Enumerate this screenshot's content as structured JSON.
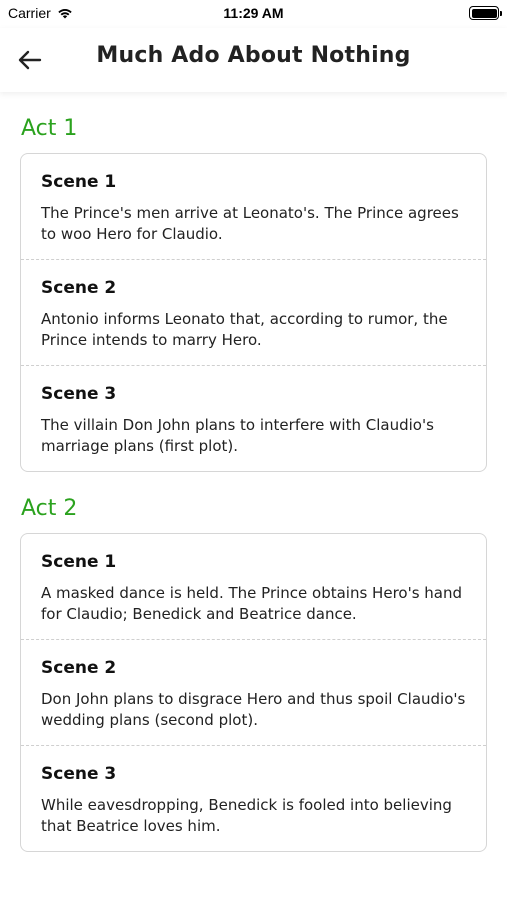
{
  "status_bar": {
    "carrier": "Carrier",
    "time": "11:29 AM"
  },
  "header": {
    "title": "Much Ado About Nothing"
  },
  "acts": [
    {
      "title": "Act 1",
      "scenes": [
        {
          "title": "Scene 1",
          "description": "The Prince's men arrive at Leonato's. The Prince agrees to woo Hero for Claudio."
        },
        {
          "title": "Scene 2",
          "description": "Antonio informs Leonato that, according to rumor, the Prince intends to marry Hero."
        },
        {
          "title": "Scene 3",
          "description": "The villain Don John plans to interfere with Claudio's marriage plans (first plot)."
        }
      ]
    },
    {
      "title": "Act 2",
      "scenes": [
        {
          "title": "Scene 1",
          "description": "A masked dance is held. The Prince obtains Hero's hand for Claudio; Benedick and Beatrice dance."
        },
        {
          "title": "Scene 2",
          "description": "Don John plans to disgrace Hero and thus spoil Claudio's wedding plans (second plot)."
        },
        {
          "title": "Scene 3",
          "description": "While eavesdropping, Benedick is fooled into believing that Beatrice loves him."
        }
      ]
    }
  ],
  "colors": {
    "accent": "#2ba21e",
    "card_border": "#d6d6d6"
  },
  "icons": {
    "back": "arrow-left-icon",
    "wifi": "wifi-icon",
    "battery": "battery-icon"
  }
}
